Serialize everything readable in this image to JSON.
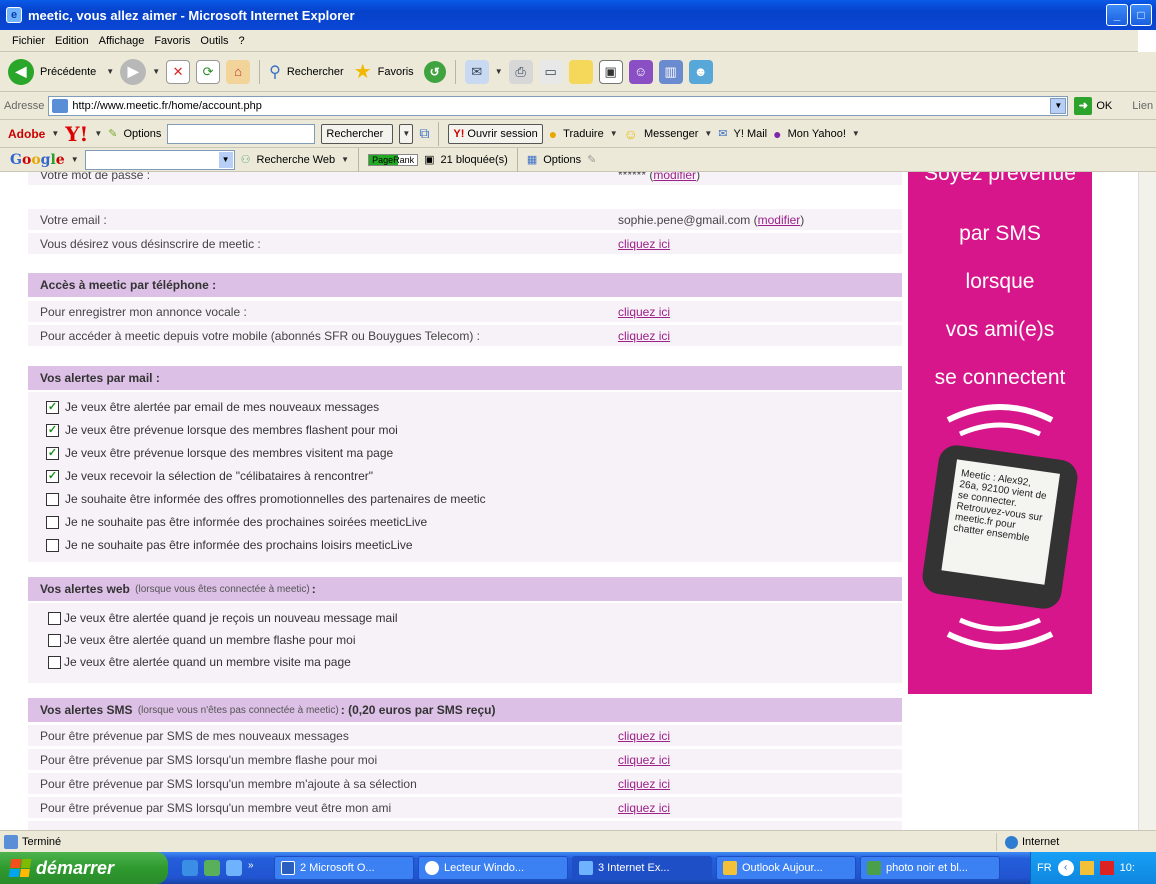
{
  "window": {
    "title": "meetic, vous allez aimer - Microsoft Internet Explorer"
  },
  "menu": [
    "Fichier",
    "Edition",
    "Affichage",
    "Favoris",
    "Outils",
    "?"
  ],
  "toolbar": {
    "back": "Précédente",
    "search": "Rechercher",
    "favorites": "Favoris"
  },
  "address": {
    "label": "Adresse",
    "url": "http://www.meetic.fr/home/account.php",
    "go": "OK",
    "links": "Lien"
  },
  "yahoo": {
    "adobe": "Adobe",
    "options": "Options",
    "search_btn": "Rechercher",
    "session": "Ouvrir session",
    "translate": "Traduire",
    "messenger": "Messenger",
    "mail": "Y! Mail",
    "myyahoo": "Mon Yahoo!"
  },
  "google": {
    "logo": "Google",
    "web_search": "Recherche Web",
    "pagerank": "PageRank",
    "blocked": "21 bloquée(s)",
    "options": "Options"
  },
  "account": {
    "password_label": "Votre mot de passe :",
    "password_value": "******",
    "modifier": "modifier",
    "email_label": "Votre email :",
    "email_value": "sophie.pene@gmail.com",
    "unsubscribe_label": "Vous désirez vous désinscrire de meetic :",
    "click_here": "cliquez ici"
  },
  "phone_section": {
    "title": "Accès à meetic par téléphone :",
    "rows": [
      "Pour enregistrer mon annonce vocale :",
      "Pour accéder à meetic depuis votre mobile (abonnés SFR ou Bouygues Telecom) :"
    ]
  },
  "mail_alerts": {
    "title": "Vos alertes par mail :",
    "items": [
      {
        "label": "Je veux être alertée par email de mes nouveaux messages",
        "checked": "✓"
      },
      {
        "label": "Je veux être prévenue lorsque des membres flashent pour moi",
        "checked": "✓"
      },
      {
        "label": "Je veux être prévenue lorsque des membres visitent ma page",
        "checked": "✓"
      },
      {
        "label": "Je veux recevoir la sélection de \"célibataires à rencontrer\"",
        "checked": "✓"
      },
      {
        "label": "Je souhaite être informée des offres promotionnelles des partenaires de meetic",
        "checked": ""
      },
      {
        "label": "Je ne souhaite pas être informée des prochaines soirées meeticLive",
        "checked": ""
      },
      {
        "label": "Je ne souhaite pas être informée des prochains loisirs meeticLive",
        "checked": ""
      }
    ]
  },
  "web_alerts": {
    "title": "Vos alertes web",
    "subtitle": "(lorsque vous êtes connectée à meetic)",
    "items": [
      "Je veux être alertée quand je reçois un nouveau message mail",
      "Je veux être alertée quand un membre flashe pour moi",
      "Je veux être alertée quand un membre visite ma page"
    ]
  },
  "sms_alerts": {
    "title": "Vos alertes SMS",
    "subtitle": "(lorsque vous n'êtes pas connectée à meetic)",
    "price": "(0,20 euros par SMS reçu)",
    "rows": [
      "Pour être prévenue par SMS de mes nouveaux messages",
      "Pour être prévenue par SMS lorsqu'un membre flashe pour moi",
      "Pour être prévenue par SMS lorsqu'un membre m'ajoute à sa sélection",
      "Pour être prévenue par SMS lorsqu'un membre veut être mon ami"
    ]
  },
  "ad": {
    "lines": [
      "Soyez prévenue",
      "par SMS",
      "lorsque",
      "vos ami(e)s",
      "se connectent"
    ],
    "phone_text": "Meetic : Alex92, 26a, 92100 vient de se connecter. Retrouvez-vous sur meetic.fr pour chatter ensemble"
  },
  "status": {
    "left": "Terminé",
    "zone": "Internet"
  },
  "taskbar": {
    "start": "démarrer",
    "tasks": [
      "2 Microsoft O...",
      "Lecteur Windo...",
      "3 Internet Ex...",
      "Outlook Aujour...",
      "photo noir et bl..."
    ],
    "lang": "FR",
    "clock": "10:"
  }
}
